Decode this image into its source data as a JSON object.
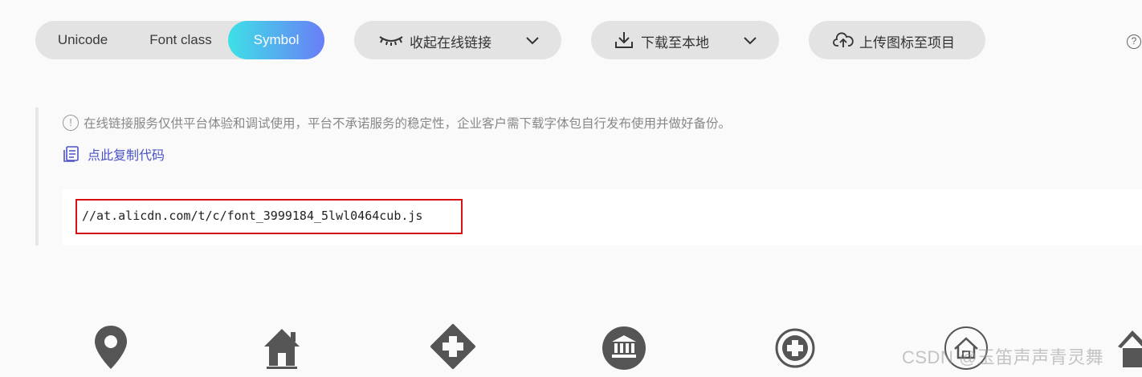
{
  "tabs": {
    "items": [
      {
        "label": "Unicode",
        "active": false
      },
      {
        "label": "Font class",
        "active": false
      },
      {
        "label": "Symbol",
        "active": true
      }
    ],
    "active_gradient": [
      "#3ee0e6",
      "#6a7ef7"
    ]
  },
  "toolbar": {
    "collapse_label": "收起在线链接",
    "download_label": "下载至本地",
    "upload_label": "上传图标至项目",
    "help_label": "?"
  },
  "notice": {
    "icon_label": "!",
    "text": "在线链接服务仅供平台体验和调试使用，平台不承诺服务的稳定性，企业客户需下载字体包自行发布使用并做好备份。"
  },
  "copy_code_label": "点此复制代码",
  "code": {
    "url": "//at.alicdn.com/t/c/font_3999184_5lwl0464cub.js"
  },
  "highlight_color": "#d61212",
  "icons_preview": [
    "location-pin-icon",
    "house-icon",
    "medical-cross-diamond-icon",
    "bank-icon",
    "medical-cross-circle-icon",
    "home-outline-icon",
    "house-partial-icon"
  ],
  "watermark": "CSDN @玉笛声声青灵舞"
}
